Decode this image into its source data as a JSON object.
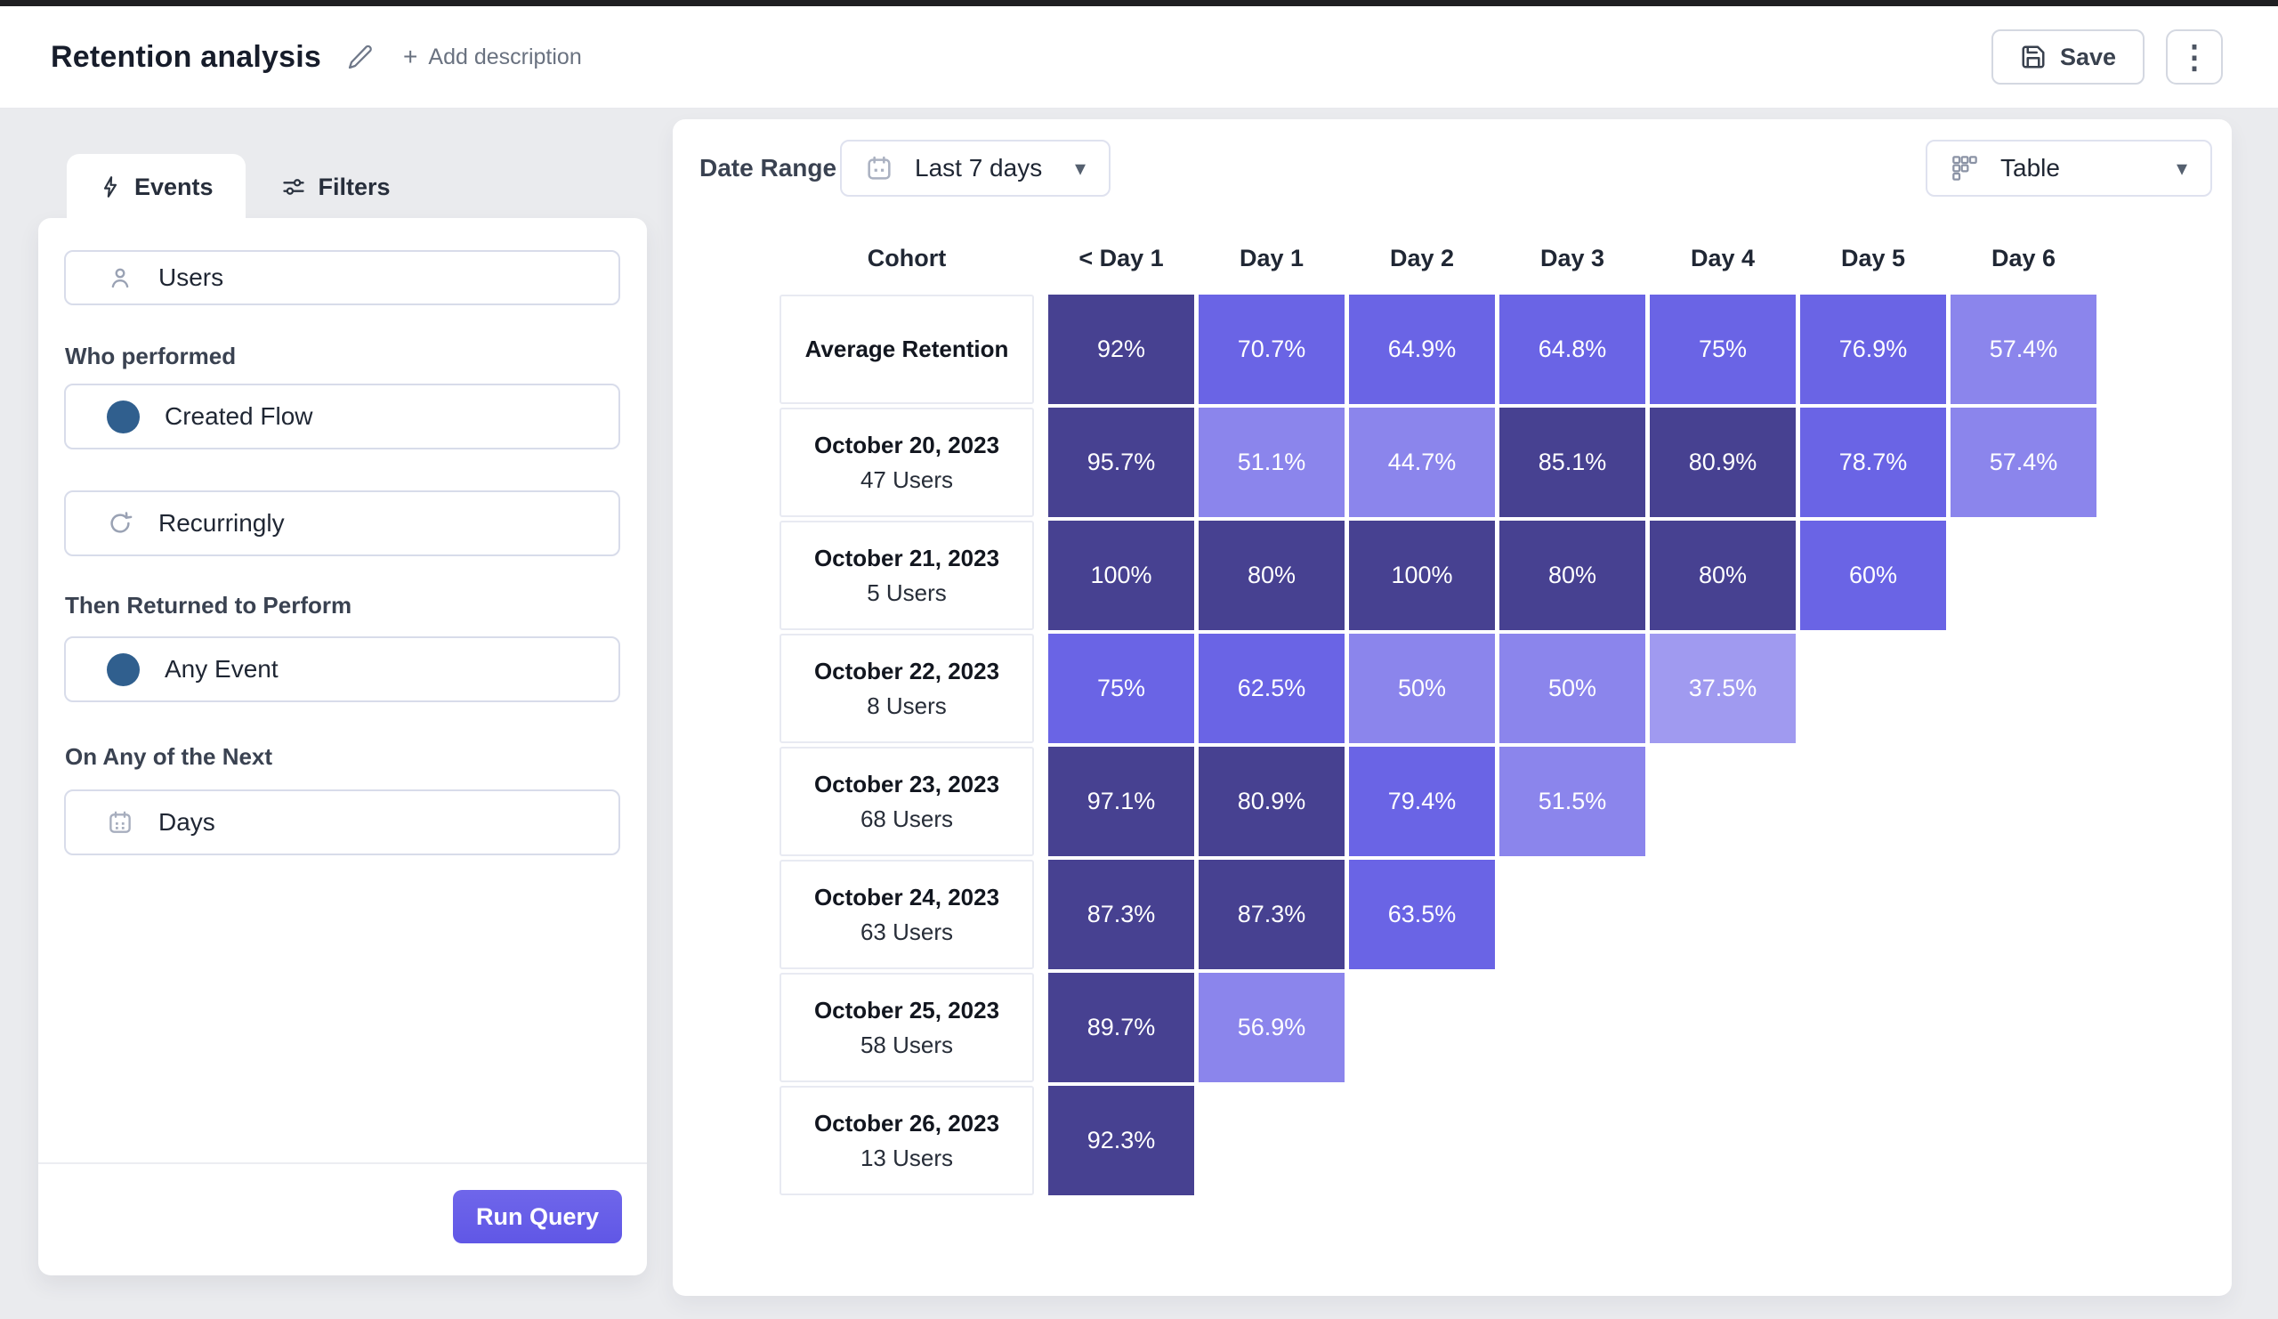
{
  "header": {
    "title": "Retention analysis",
    "add_description_label": "Add description",
    "save_label": "Save"
  },
  "icons": {
    "plus": "+",
    "caret_down": "▾",
    "kebab": "⋮",
    "named_svg_icons": [
      "pencil-icon",
      "save-icon",
      "bolt-icon",
      "sliders-icon",
      "user-icon",
      "refresh-icon",
      "calendar-icon",
      "table-view-icon"
    ]
  },
  "panel": {
    "tabs": [
      {
        "label": "Events"
      },
      {
        "label": "Filters"
      }
    ],
    "users_label": "Users",
    "who_performed_label": "Who performed",
    "performed_event": "Created Flow",
    "frequency": "Recurringly",
    "then_returned_label": "Then Returned to Perform",
    "return_event": "Any Event",
    "on_any_next_label": "On Any of the Next",
    "next_unit": "Days",
    "run_query_label": "Run Query"
  },
  "toolbar": {
    "date_range_label": "Date Range",
    "date_range_value": "Last 7 days",
    "view_label": "Table"
  },
  "chart_data": {
    "type": "heatmap",
    "title": "Retention analysis",
    "value_format": "percent",
    "columns": [
      "Cohort",
      "< Day 1",
      "Day 1",
      "Day 2",
      "Day 3",
      "Day 4",
      "Day 5",
      "Day 6"
    ],
    "rows": [
      {
        "label": "Average Retention",
        "sublabel": "",
        "values": [
          92,
          70.7,
          64.9,
          64.8,
          75,
          76.9,
          57.4
        ]
      },
      {
        "label": "October 20, 2023",
        "sublabel": "47 Users",
        "values": [
          95.7,
          51.1,
          44.7,
          85.1,
          80.9,
          78.7,
          57.4
        ]
      },
      {
        "label": "October 21, 2023",
        "sublabel": "5 Users",
        "values": [
          100,
          80,
          100,
          80,
          80,
          60
        ]
      },
      {
        "label": "October 22, 2023",
        "sublabel": "8 Users",
        "values": [
          75,
          62.5,
          50,
          50,
          37.5
        ]
      },
      {
        "label": "October 23, 2023",
        "sublabel": "68 Users",
        "values": [
          97.1,
          80.9,
          79.4,
          51.5
        ]
      },
      {
        "label": "October 24, 2023",
        "sublabel": "63 Users",
        "values": [
          87.3,
          87.3,
          63.5
        ]
      },
      {
        "label": "October 25, 2023",
        "sublabel": "58 Users",
        "values": [
          89.7,
          56.9
        ]
      },
      {
        "label": "October 26, 2023",
        "sublabel": "13 Users",
        "values": [
          92.3
        ]
      }
    ],
    "color_scale": {
      "thresholds": [
        80,
        60,
        40
      ],
      "dark": "#474191",
      "medium": "#6A64E5",
      "light": "#8B85EC",
      "lightest": "#A09AF0"
    }
  }
}
